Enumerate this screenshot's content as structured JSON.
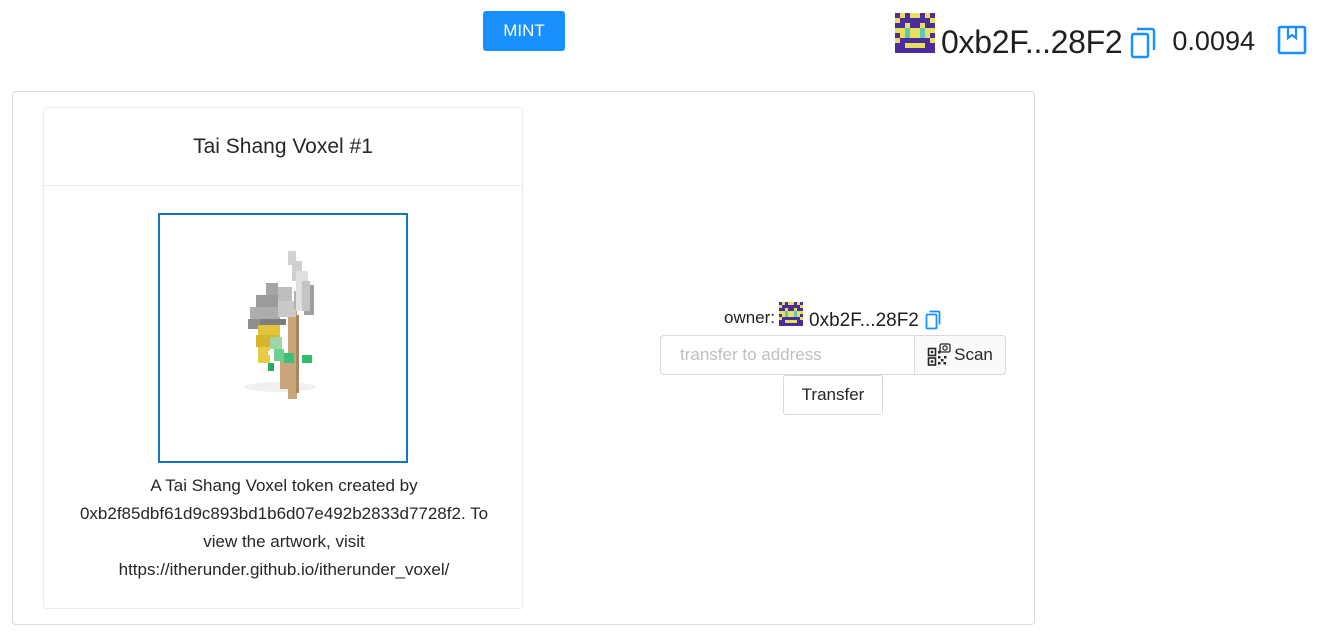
{
  "header": {
    "mint_label": "MINT",
    "account": {
      "address_short": "0xb2F...28F2",
      "balance": "0.0094"
    }
  },
  "token_card": {
    "title": "Tai Shang Voxel #1",
    "description": "A Tai Shang Voxel token created by 0xb2f85dbf61d9c893bd1b6d07e492b2833d7728f2. To view the artwork, visit https://itherunder.github.io/itherunder_voxel/"
  },
  "transfer": {
    "owner_label": "owner:",
    "owner_address_short": "0xb2F...28F2",
    "input_placeholder": "transfer to address",
    "scan_label": "Scan",
    "transfer_label": "Transfer"
  },
  "colors": {
    "primary": "#1890ff",
    "art_border": "#1873c4"
  }
}
